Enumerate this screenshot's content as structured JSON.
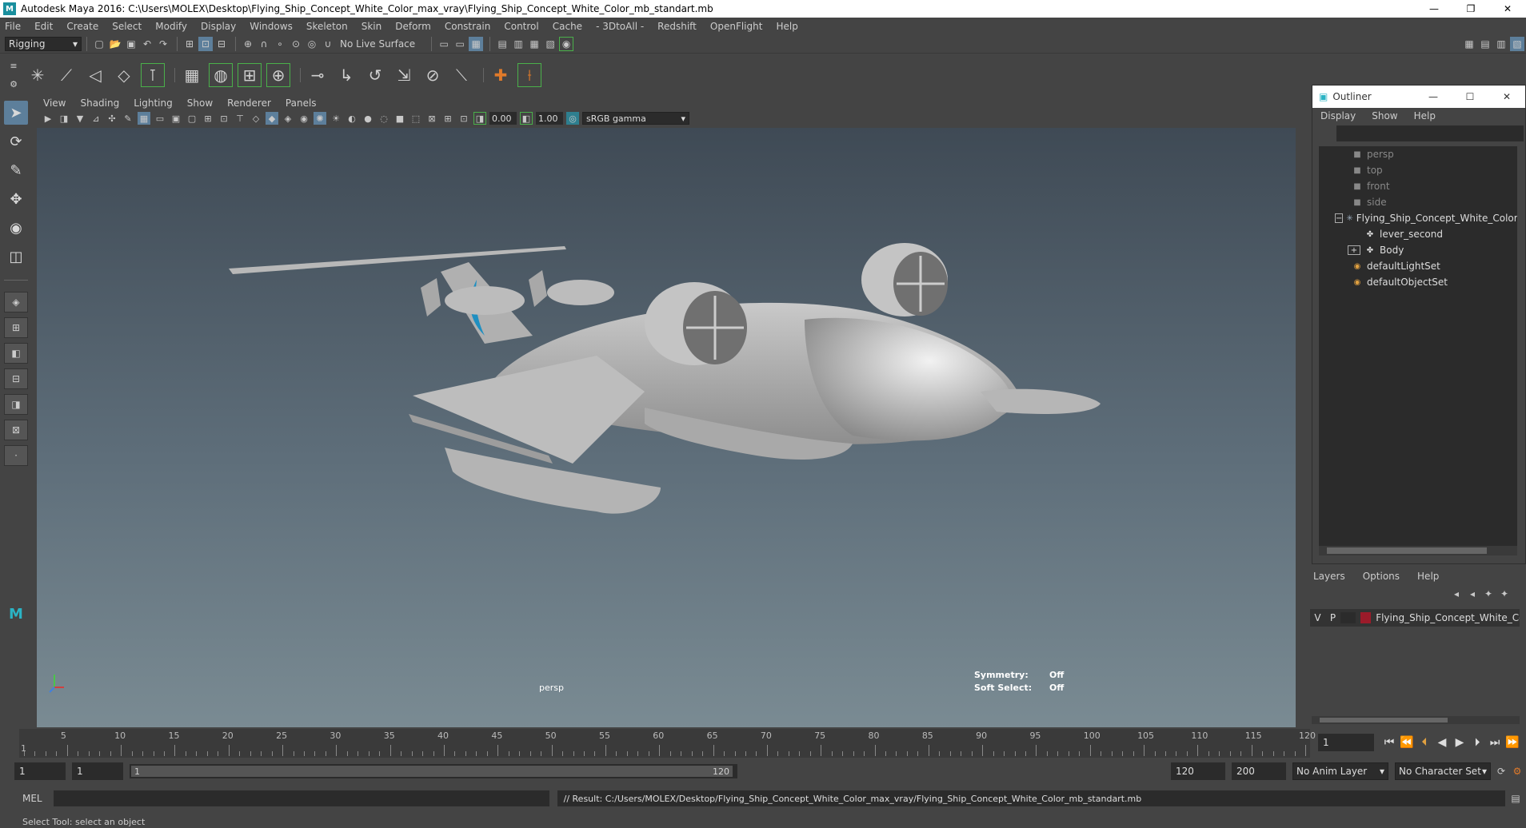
{
  "window": {
    "title": "Autodesk Maya 2016: C:\\Users\\MOLEX\\Desktop\\Flying_Ship_Concept_White_Color_max_vray\\Flying_Ship_Concept_White_Color_mb_standart.mb",
    "minimize": "—",
    "restore": "❐",
    "close": "✕"
  },
  "menubar": [
    "File",
    "Edit",
    "Create",
    "Select",
    "Modify",
    "Display",
    "Windows",
    "Skeleton",
    "Skin",
    "Deform",
    "Constrain",
    "Control",
    "Cache",
    "- 3DtoAll -",
    "Redshift",
    "OpenFlight",
    "Help"
  ],
  "statusline": {
    "menuset": "Rigging",
    "live_surface": "No Live Surface"
  },
  "viewport": {
    "menu": [
      "View",
      "Shading",
      "Lighting",
      "Show",
      "Renderer",
      "Panels"
    ],
    "exposure": "0.00",
    "gamma": "1.00",
    "colorspace": "sRGB gamma",
    "camera_label": "persp",
    "symmetry_label": "Symmetry:",
    "symmetry_value": "Off",
    "soft_select_label": "Soft Select:",
    "soft_select_value": "Off"
  },
  "outliner": {
    "title": "Outliner",
    "menu": [
      "Display",
      "Show",
      "Help"
    ],
    "items": [
      {
        "label": "persp",
        "icon": "camera-icon",
        "dim": true
      },
      {
        "label": "top",
        "icon": "camera-icon",
        "dim": true
      },
      {
        "label": "front",
        "icon": "camera-icon",
        "dim": true
      },
      {
        "label": "side",
        "icon": "camera-icon",
        "dim": true
      },
      {
        "label": "Flying_Ship_Concept_White_Color_n",
        "icon": "joint-icon",
        "dim": false
      },
      {
        "label": "lever_second",
        "icon": "mesh-icon",
        "dim": false
      },
      {
        "label": "Body",
        "icon": "mesh-icon",
        "dim": false
      },
      {
        "label": "defaultLightSet",
        "icon": "set-icon",
        "dim": false
      },
      {
        "label": "defaultObjectSet",
        "icon": "set-icon",
        "dim": false
      }
    ]
  },
  "layers": {
    "menu": [
      "Layers",
      "Options",
      "Help"
    ],
    "row": {
      "v": "V",
      "p": "P",
      "name": "Flying_Ship_Concept_White_Col",
      "color": "#9b1b2a"
    }
  },
  "timeslider": {
    "ticks": [
      "5",
      "10",
      "15",
      "20",
      "25",
      "30",
      "35",
      "40",
      "45",
      "50",
      "55",
      "60",
      "65",
      "70",
      "75",
      "80",
      "85",
      "90",
      "95",
      "100",
      "105",
      "110",
      "115",
      "120"
    ],
    "start_marker": "1",
    "current_frame": "1"
  },
  "range": {
    "start": "1",
    "start2": "1",
    "slider_start": "1",
    "slider_end": "120",
    "end": "120",
    "end2": "200",
    "anim_layer": "No Anim Layer",
    "char_set": "No Character Set"
  },
  "mel": {
    "label": "MEL",
    "result": "// Result: C:/Users/MOLEX/Desktop/Flying_Ship_Concept_White_Color_max_vray/Flying_Ship_Concept_White_Color_mb_standart.mb"
  },
  "helpline": "Select Tool: select an object"
}
